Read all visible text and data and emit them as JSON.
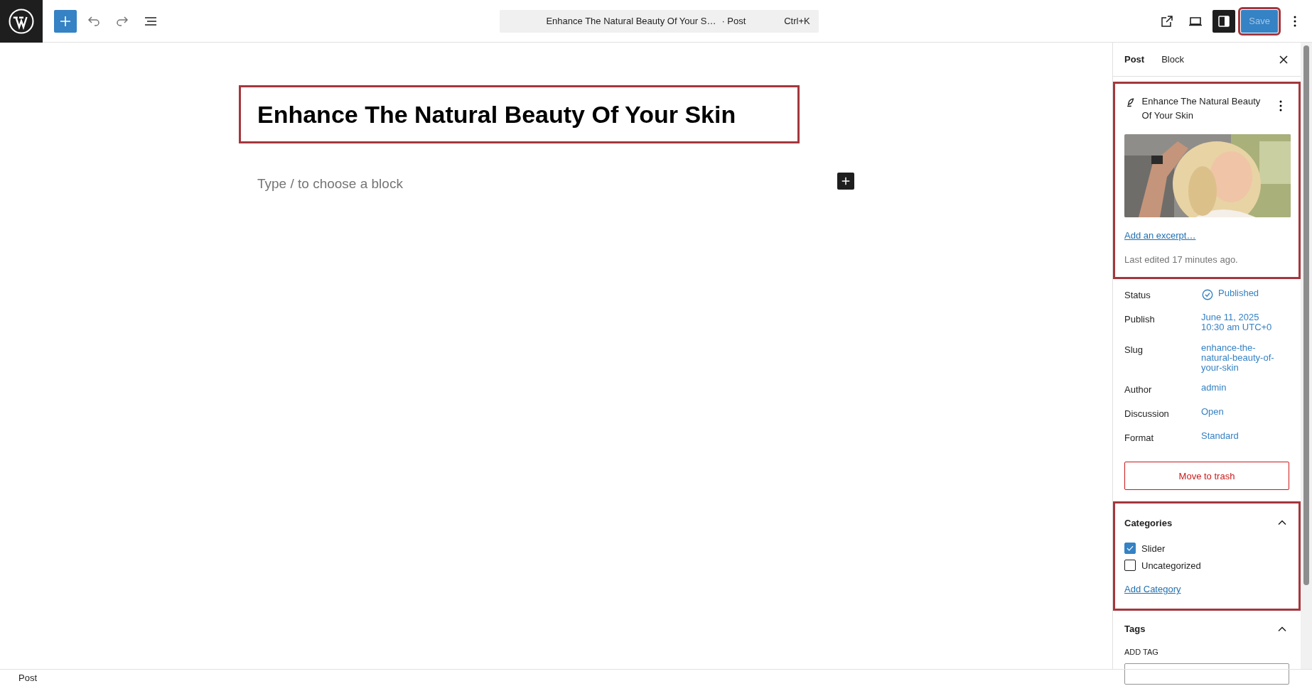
{
  "toolbar": {
    "command_title": "Enhance The Natural Beauty Of Your S…",
    "command_type": "· Post",
    "shortcut": "Ctrl+K",
    "save_button": {
      "label": "Save",
      "highlighted": true
    }
  },
  "editor": {
    "title": "Enhance The Natural Beauty Of Your Skin",
    "title_highlighted": true,
    "placeholder": "Type / to choose a block"
  },
  "sidebar": {
    "tabs": [
      {
        "label": "Post",
        "selected": true
      },
      {
        "label": "Block",
        "selected": false
      }
    ],
    "summary": {
      "title": "Enhance The Natural Beauty Of Your Skin",
      "excerpt_link": "Add an excerpt…",
      "last_edited": "Last edited 17 minutes ago.",
      "highlighted": true
    },
    "fields": [
      {
        "label": "Status",
        "kind": "status",
        "lines": [
          "Published"
        ]
      },
      {
        "label": "Publish",
        "kind": "link",
        "lines": [
          "June 11, 2025",
          "10:30 am UTC+0"
        ]
      },
      {
        "label": "Slug",
        "kind": "link",
        "lines": [
          "enhance-the-",
          "natural-beauty-of-",
          "your-skin"
        ]
      },
      {
        "label": "Author",
        "kind": "link",
        "lines": [
          "admin"
        ]
      },
      {
        "label": "Discussion",
        "kind": "link",
        "lines": [
          "Open"
        ]
      },
      {
        "label": "Format",
        "kind": "link",
        "lines": [
          "Standard"
        ]
      }
    ],
    "trash_button": "Move to trash",
    "categories": {
      "title": "Categories",
      "expanded": true,
      "highlighted": true,
      "items": [
        {
          "label": "Slider",
          "checked": true
        },
        {
          "label": "Uncategorized",
          "checked": false
        }
      ],
      "add_link": "Add Category"
    },
    "tags": {
      "title": "Tags",
      "expanded": true,
      "field_label": "ADD TAG"
    }
  },
  "footer": {
    "breadcrumb": "Post"
  }
}
